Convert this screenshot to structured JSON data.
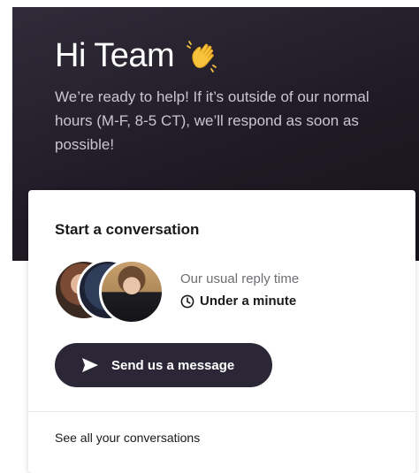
{
  "header": {
    "greeting": "Hi Team",
    "greeting_icon": "waving-hand-icon",
    "subtitle": "We’re ready to help! If it’s outside of our normal hours (M-F, 8-5 CT), we’ll respond as soon as possible!"
  },
  "card": {
    "title": "Start a conversation",
    "reply_label": "Our usual reply time",
    "reply_time": "Under a minute",
    "send_button_label": "Send us a message",
    "see_all_label": "See all your conversations"
  },
  "colors": {
    "header_background": "#221e29",
    "button_background": "#2c2736",
    "text_primary": "#1a1a1a",
    "text_muted": "#6e6e73"
  }
}
